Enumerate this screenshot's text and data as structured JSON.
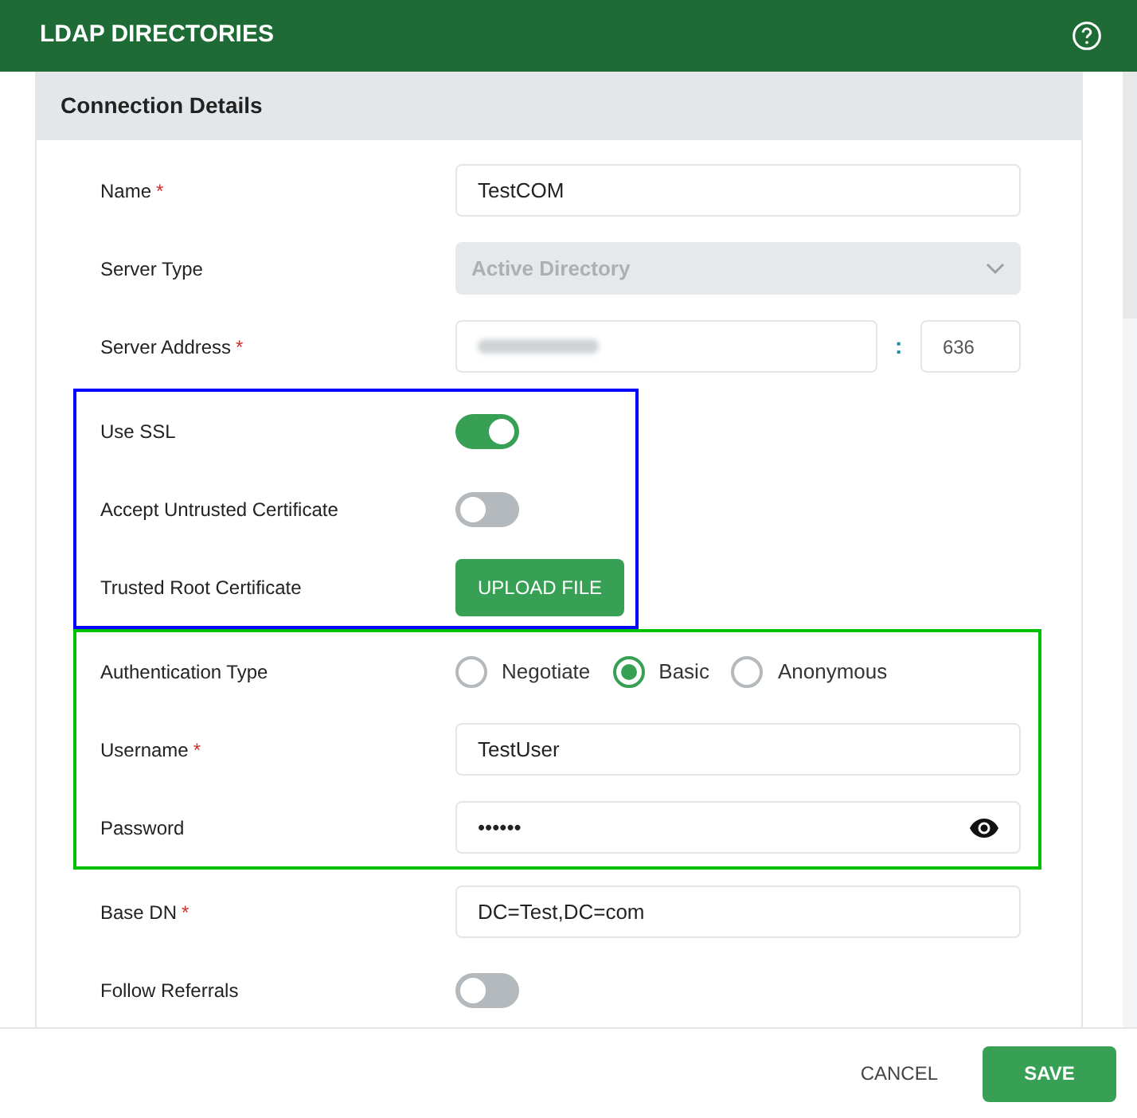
{
  "header": {
    "title": "LDAP DIRECTORIES"
  },
  "card": {
    "title": "Connection Details"
  },
  "sections": [
    {
      "fields": [
        {
          "kind": "text",
          "label": "Name",
          "marker": "*",
          "value": "TestCOM"
        },
        {
          "kind": "select",
          "label": "Server Type",
          "value": "Active Directory",
          "disabled": true
        },
        {
          "kind": "address",
          "label": "Server Address",
          "marker": "*",
          "separator": ":",
          "port": "636"
        }
      ]
    },
    {
      "color": "#0000ff",
      "fields": [
        {
          "kind": "toggle",
          "label": "Use SSL",
          "on": true
        },
        {
          "kind": "toggle",
          "label": "Accept Untrusted Certificate",
          "on": false
        },
        {
          "kind": "upload",
          "label": "Trusted Root Certificate",
          "button": "UPLOAD FILE"
        }
      ]
    },
    {
      "color": "#00c000",
      "fields": [
        {
          "kind": "radio",
          "label": "Authentication Type",
          "options": [
            {
              "label": "Negotiate",
              "selected": false
            },
            {
              "label": "Basic",
              "selected": true
            },
            {
              "label": "Anonymous",
              "selected": false
            }
          ]
        },
        {
          "kind": "text",
          "label": "Username",
          "marker": "*",
          "value": "TestUser"
        },
        {
          "kind": "password",
          "label": "Password",
          "value": "••••••"
        }
      ]
    },
    {
      "fields": [
        {
          "kind": "text",
          "label": "Base DN",
          "marker": "*",
          "value": "DC=Test,DC=com"
        },
        {
          "kind": "toggle",
          "label": "Follow Referrals",
          "on": false
        }
      ]
    }
  ],
  "footer": {
    "cancel": "CANCEL",
    "save": "SAVE"
  }
}
